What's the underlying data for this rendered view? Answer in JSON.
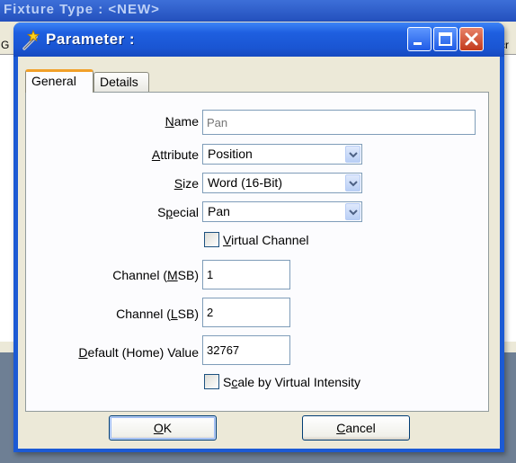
{
  "background_window": {
    "title": "Fixture Type : <NEW>",
    "left_fragment": "G",
    "right_fragment": "cr"
  },
  "dialog": {
    "title": "Parameter :",
    "tabs": [
      {
        "label": "General",
        "active": true
      },
      {
        "label": "Details",
        "active": false
      }
    ],
    "fields": {
      "name": {
        "label_before": "",
        "label_mnemonic": "N",
        "label_after": "ame",
        "placeholder": "Pan"
      },
      "attribute": {
        "label_before": "",
        "label_mnemonic": "A",
        "label_after": "ttribute",
        "value": "Position"
      },
      "size": {
        "label_before": "",
        "label_mnemonic": "S",
        "label_after": "ize",
        "value": "Word (16-Bit)"
      },
      "special": {
        "label_before": "S",
        "label_mnemonic": "p",
        "label_after": "ecial",
        "value": "Pan"
      },
      "virtual_channel": {
        "label_before": "",
        "label_mnemonic": "V",
        "label_after": "irtual Channel",
        "checked": false
      },
      "channel_msb": {
        "label_before": "Channel (",
        "label_mnemonic": "M",
        "label_after": "SB)",
        "value": "1"
      },
      "channel_lsb": {
        "label_before": "Channel (",
        "label_mnemonic": "L",
        "label_after": "SB)",
        "value": "2"
      },
      "default_value": {
        "label_before": "",
        "label_mnemonic": "D",
        "label_after": "efault (Home) Value",
        "value": "32767"
      },
      "scale_virtual_intensity": {
        "label_before": "S",
        "label_mnemonic": "c",
        "label_after": "ale by Virtual Intensity",
        "checked": false
      }
    },
    "buttons": {
      "ok": {
        "label_before": "",
        "label_mnemonic": "O",
        "label_after": "K"
      },
      "cancel": {
        "label_before": "",
        "label_mnemonic": "C",
        "label_after": "ancel"
      }
    }
  },
  "colors": {
    "titlebar_blue": "#1e5fe0",
    "dialog_face": "#ece9d8",
    "close_red": "#c2391b",
    "tab_highlight": "#f1a02a",
    "field_border": "#7f9db9"
  },
  "icons": {
    "title": "wand-icon",
    "minimize": "minimize-icon",
    "maximize": "maximize-icon",
    "close": "close-icon",
    "dropdown": "chevron-down-icon"
  }
}
